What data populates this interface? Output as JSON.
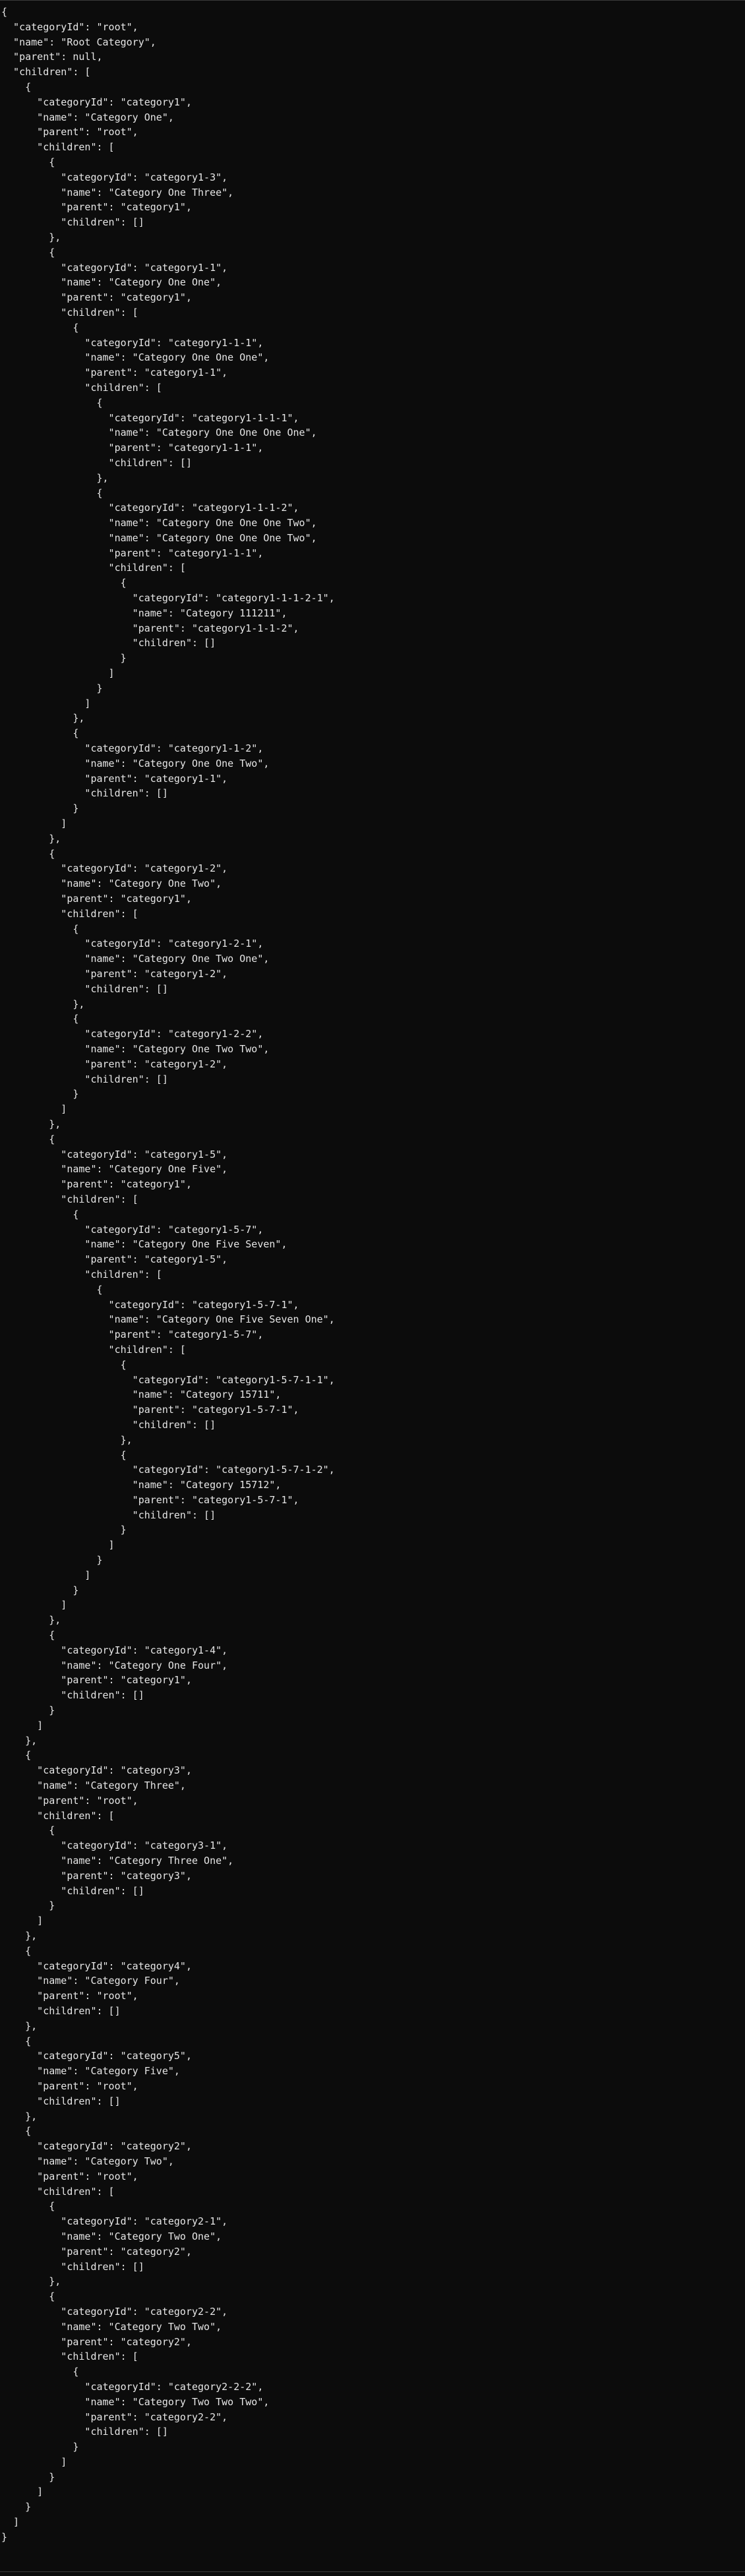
{
  "console": {
    "text": "{\n  \"categoryId\": \"root\",\n  \"name\": \"Root Category\",\n  \"parent\": null,\n  \"children\": [\n    {\n      \"categoryId\": \"category1\",\n      \"name\": \"Category One\",\n      \"parent\": \"root\",\n      \"children\": [\n        {\n          \"categoryId\": \"category1-3\",\n          \"name\": \"Category One Three\",\n          \"parent\": \"category1\",\n          \"children\": []\n        },\n        {\n          \"categoryId\": \"category1-1\",\n          \"name\": \"Category One One\",\n          \"parent\": \"category1\",\n          \"children\": [\n            {\n              \"categoryId\": \"category1-1-1\",\n              \"name\": \"Category One One One\",\n              \"parent\": \"category1-1\",\n              \"children\": [\n                {\n                  \"categoryId\": \"category1-1-1-1\",\n                  \"name\": \"Category One One One One\",\n                  \"parent\": \"category1-1-1\",\n                  \"children\": []\n                },\n                {\n                  \"categoryId\": \"category1-1-1-2\",\n                  \"name\": \"Category One One One Two\",\n                  \"name\": \"Category One One One Two\",\n                  \"parent\": \"category1-1-1\",\n                  \"children\": [\n                    {\n                      \"categoryId\": \"category1-1-1-2-1\",\n                      \"name\": \"Category 111211\",\n                      \"parent\": \"category1-1-1-2\",\n                      \"children\": []\n                    }\n                  ]\n                }\n              ]\n            },\n            {\n              \"categoryId\": \"category1-1-2\",\n              \"name\": \"Category One One Two\",\n              \"parent\": \"category1-1\",\n              \"children\": []\n            }\n          ]\n        },\n        {\n          \"categoryId\": \"category1-2\",\n          \"name\": \"Category One Two\",\n          \"parent\": \"category1\",\n          \"children\": [\n            {\n              \"categoryId\": \"category1-2-1\",\n              \"name\": \"Category One Two One\",\n              \"parent\": \"category1-2\",\n              \"children\": []\n            },\n            {\n              \"categoryId\": \"category1-2-2\",\n              \"name\": \"Category One Two Two\",\n              \"parent\": \"category1-2\",\n              \"children\": []\n            }\n          ]\n        },\n        {\n          \"categoryId\": \"category1-5\",\n          \"name\": \"Category One Five\",\n          \"parent\": \"category1\",\n          \"children\": [\n            {\n              \"categoryId\": \"category1-5-7\",\n              \"name\": \"Category One Five Seven\",\n              \"parent\": \"category1-5\",\n              \"children\": [\n                {\n                  \"categoryId\": \"category1-5-7-1\",\n                  \"name\": \"Category One Five Seven One\",\n                  \"parent\": \"category1-5-7\",\n                  \"children\": [\n                    {\n                      \"categoryId\": \"category1-5-7-1-1\",\n                      \"name\": \"Category 15711\",\n                      \"parent\": \"category1-5-7-1\",\n                      \"children\": []\n                    },\n                    {\n                      \"categoryId\": \"category1-5-7-1-2\",\n                      \"name\": \"Category 15712\",\n                      \"parent\": \"category1-5-7-1\",\n                      \"children\": []\n                    }\n                  ]\n                }\n              ]\n            }\n          ]\n        },\n        {\n          \"categoryId\": \"category1-4\",\n          \"name\": \"Category One Four\",\n          \"parent\": \"category1\",\n          \"children\": []\n        }\n      ]\n    },\n    {\n      \"categoryId\": \"category3\",\n      \"name\": \"Category Three\",\n      \"parent\": \"root\",\n      \"children\": [\n        {\n          \"categoryId\": \"category3-1\",\n          \"name\": \"Category Three One\",\n          \"parent\": \"category3\",\n          \"children\": []\n        }\n      ]\n    },\n    {\n      \"categoryId\": \"category4\",\n      \"name\": \"Category Four\",\n      \"parent\": \"root\",\n      \"children\": []\n    },\n    {\n      \"categoryId\": \"category5\",\n      \"name\": \"Category Five\",\n      \"parent\": \"root\",\n      \"children\": []\n    },\n    {\n      \"categoryId\": \"category2\",\n      \"name\": \"Category Two\",\n      \"parent\": \"root\",\n      \"children\": [\n        {\n          \"categoryId\": \"category2-1\",\n          \"name\": \"Category Two One\",\n          \"parent\": \"category2\",\n          \"children\": []\n        },\n        {\n          \"categoryId\": \"category2-2\",\n          \"name\": \"Category Two Two\",\n          \"parent\": \"category2\",\n          \"children\": [\n            {\n              \"categoryId\": \"category2-2-2\",\n              \"name\": \"Category Two Two Two\",\n              \"parent\": \"category2-2\",\n              \"children\": []\n            }\n          ]\n        }\n      ]\n    }\n  ]\n}"
  },
  "colors": {
    "background": "#0c0c0c",
    "text": "#e6e6e6"
  }
}
